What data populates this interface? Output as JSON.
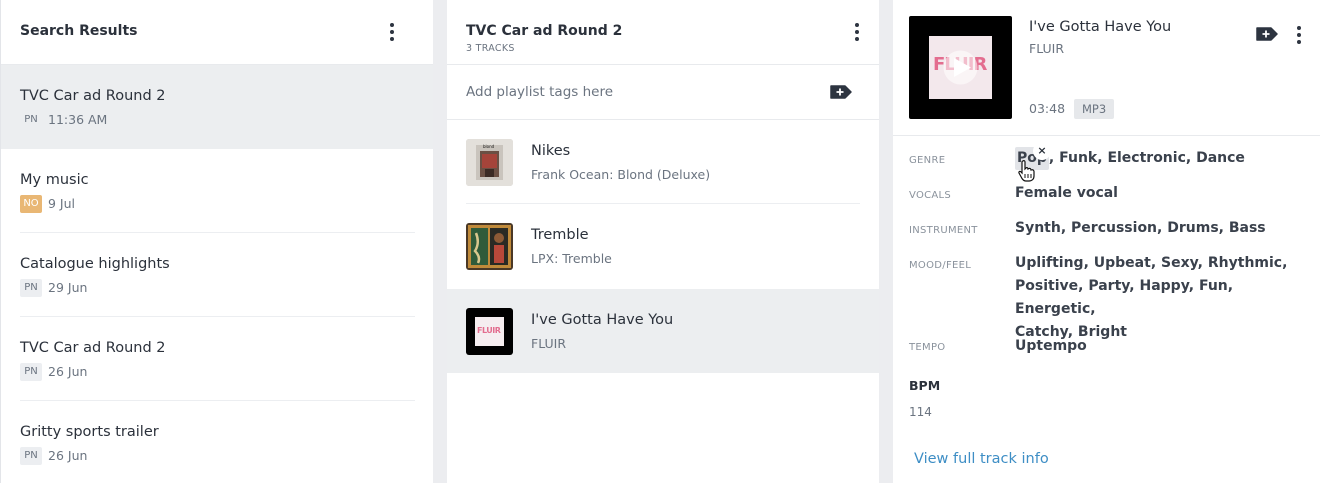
{
  "search_panel": {
    "title": "Search Results",
    "items": [
      {
        "name": "TVC Car ad Round 2",
        "badge": "PN",
        "date": "11:36 AM"
      },
      {
        "name": "My music",
        "badge": "NO",
        "date": "9 Jul"
      },
      {
        "name": "Catalogue highlights",
        "badge": "PN",
        "date": "29 Jun"
      },
      {
        "name": "TVC Car ad Round 2",
        "badge": "PN",
        "date": "26 Jun"
      },
      {
        "name": "Gritty sports trailer",
        "badge": "PN",
        "date": "26 Jun"
      }
    ]
  },
  "playlist_panel": {
    "title": "TVC Car ad Round 2",
    "subtitle": "3 TRACKS",
    "tags_placeholder": "Add playlist tags here",
    "tracks": [
      {
        "title": "Nikes",
        "subtitle": "Frank Ocean: Blond (Deluxe)",
        "art_text": "blond"
      },
      {
        "title": "Tremble",
        "subtitle": "LPX: Tremble"
      },
      {
        "title": "I've Gotta Have You",
        "subtitle": "FLUIR",
        "art_text": "FLUIR"
      }
    ]
  },
  "track_panel": {
    "title": "I've Gotta Have You",
    "artist": "FLUIR",
    "duration": "03:48",
    "format": "MP3",
    "cover_text": "FLUIR",
    "genre_label": "GENRE",
    "genres": [
      "Pop",
      "Funk",
      "Electronic",
      "Dance"
    ],
    "vocals_label": "VOCALS",
    "vocals": [
      "Female vocal"
    ],
    "instrument_label": "INSTRUMENT",
    "instruments": [
      "Synth",
      "Percussion",
      "Drums",
      "Bass"
    ],
    "mood_label": "MOOD/FEEL",
    "moods": [
      "Uplifting",
      "Upbeat",
      "Sexy",
      "Rhythmic",
      "Positive",
      "Party",
      "Happy",
      "Fun",
      "Energetic",
      "Catchy",
      "Bright"
    ],
    "tempo_label": "TEMPO",
    "tempo": [
      "Uptempo"
    ],
    "bpm_label": "BPM",
    "bpm_value": "114",
    "tag_close": "×",
    "link": "View full track info"
  },
  "colors": {
    "background": "#ecedf0",
    "link": "#3e8ec5",
    "badge_no": "#e9b774",
    "selected_row": "#eceef0"
  },
  "icons": [
    "kebab-menu-icon",
    "add-tag-icon",
    "play-icon",
    "hand-cursor-icon",
    "close-icon"
  ]
}
